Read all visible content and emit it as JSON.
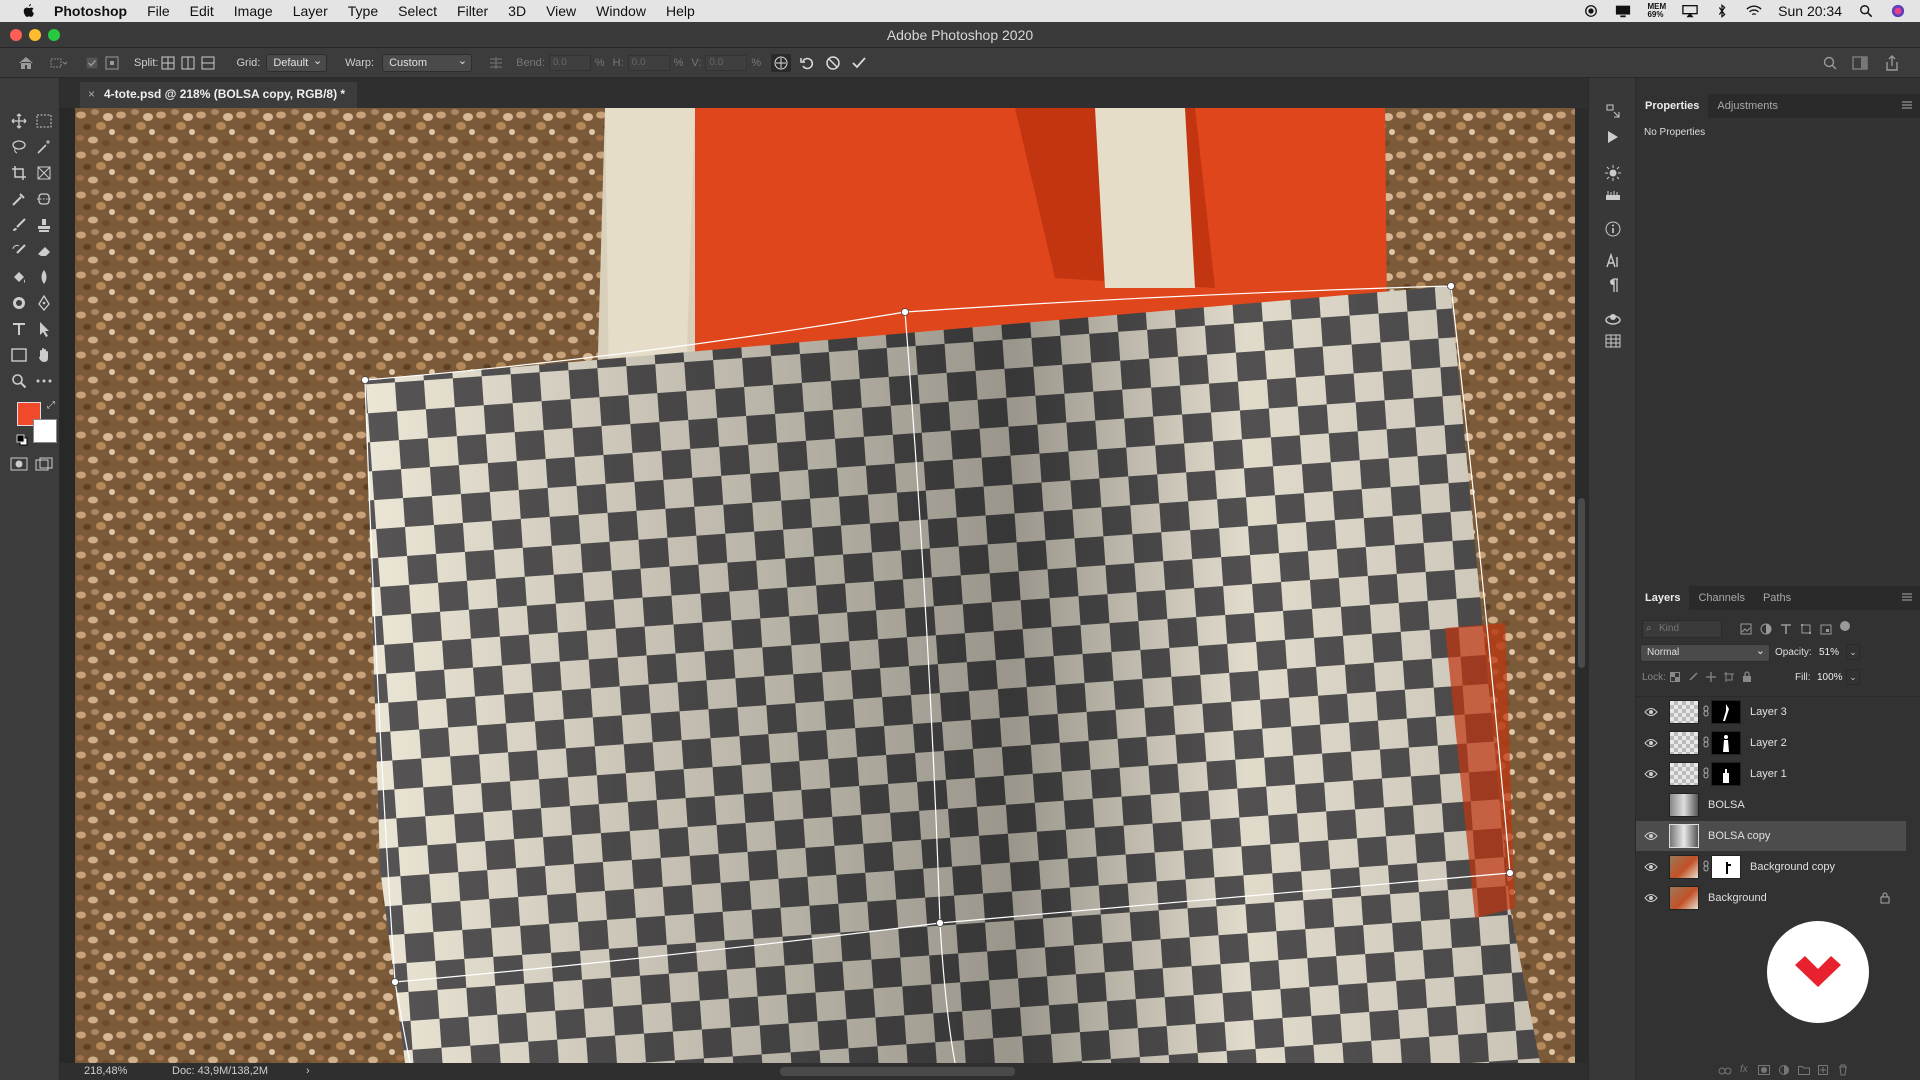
{
  "menubar": {
    "app": "Photoshop",
    "items": [
      "File",
      "Edit",
      "Image",
      "Layer",
      "Type",
      "Select",
      "Filter",
      "3D",
      "View",
      "Window",
      "Help"
    ],
    "memory_label": "MEM",
    "memory_value": "69%",
    "clock": "Sun 20:34"
  },
  "window": {
    "title": "Adobe Photoshop 2020"
  },
  "options": {
    "split_label": "Split:",
    "grid_label": "Grid:",
    "grid_value": "Default",
    "warp_label": "Warp:",
    "warp_value": "Custom",
    "bend_label": "Bend:",
    "bend_value": "0.0",
    "h_label": "H:",
    "h_value": "0.0",
    "v_label": "V:",
    "v_value": "0.0",
    "percent": "%"
  },
  "document": {
    "tab_label": "4-tote.psd @ 218% (BOLSA copy, RGB/8) *",
    "close": "×"
  },
  "status": {
    "zoom": "218,48%",
    "doc": "Doc: 43,9M/138,2M",
    "arrow": "›"
  },
  "colors": {
    "foreground": "#f04a2a",
    "background": "#ffffff",
    "accent": "#e8212f"
  },
  "properties": {
    "tabs": [
      "Properties",
      "Adjustments"
    ],
    "content": "No Properties"
  },
  "layers_panel": {
    "tabs": [
      "Layers",
      "Channels",
      "Paths"
    ],
    "filter_placeholder": "Kind",
    "blend_mode": "Normal",
    "opacity_label": "Opacity:",
    "opacity_value": "51%",
    "lock_label": "Lock:",
    "fill_label": "Fill:",
    "fill_value": "100%",
    "layers": [
      {
        "name": "Layer 3",
        "visible": true,
        "mask": true
      },
      {
        "name": "Layer 2",
        "visible": true,
        "mask": true
      },
      {
        "name": "Layer 1",
        "visible": true,
        "mask": true
      },
      {
        "name": "BOLSA",
        "visible": false,
        "mask": false
      },
      {
        "name": "BOLSA copy",
        "visible": true,
        "mask": false,
        "selected": true
      },
      {
        "name": "Background copy",
        "visible": true,
        "mask": true
      },
      {
        "name": "Background",
        "visible": true,
        "mask": false,
        "locked": true
      }
    ]
  }
}
